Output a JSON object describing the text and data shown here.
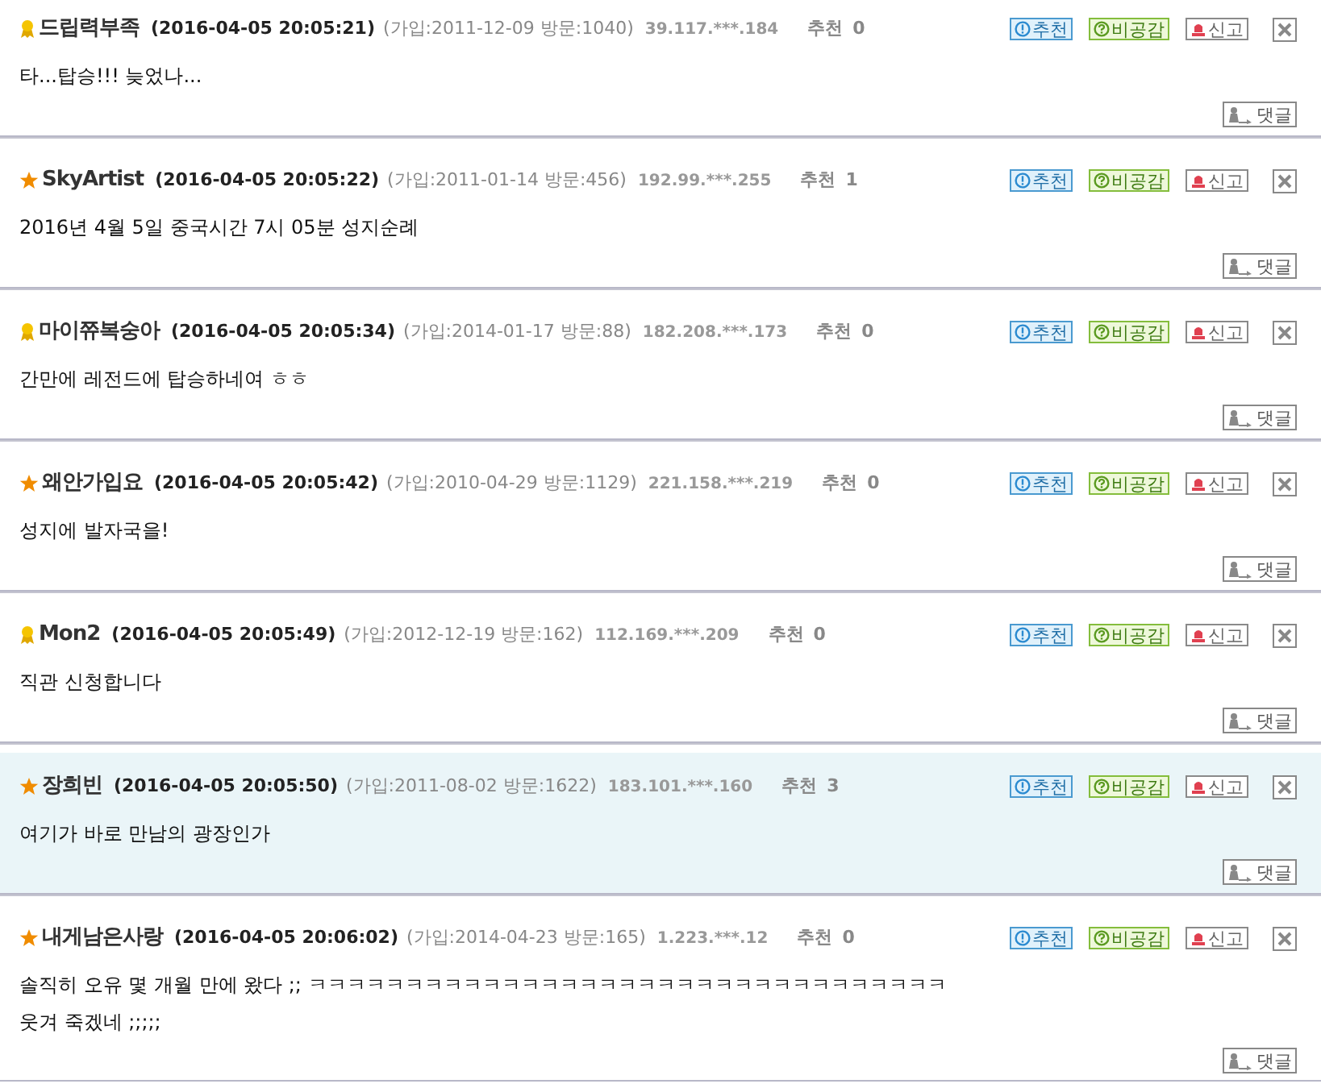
{
  "comments": [
    {
      "kind": "ribbon",
      "nickname": "드립력부족",
      "datetime": "(2016-04-05 20:05:21)",
      "member_info": "(가입:2011-12-09 방문:1040)",
      "ip": "39.117.***.184",
      "recommend_label": "추천",
      "recommend_count": "0",
      "highlighted": false,
      "lines": [
        "타...탑승!!! 늦었나..."
      ],
      "actions": [
        {
          "kind": "recommend",
          "label": "추천"
        },
        {
          "kind": "dislike",
          "label": "비공감"
        },
        {
          "kind": "report",
          "label": "신고"
        }
      ],
      "reply_label": "댓글"
    },
    {
      "kind": "star",
      "nickname": "SkyArtist",
      "datetime": "(2016-04-05 20:05:22)",
      "member_info": "(가입:2011-01-14 방문:456)",
      "ip": "192.99.***.255",
      "recommend_label": "추천",
      "recommend_count": "1",
      "highlighted": false,
      "lines": [
        "2016년 4월 5일 중국시간 7시 05분 성지순례"
      ],
      "actions": [
        {
          "kind": "recommend",
          "label": "추천"
        },
        {
          "kind": "dislike",
          "label": "비공감"
        },
        {
          "kind": "report",
          "label": "신고"
        }
      ],
      "reply_label": "댓글"
    },
    {
      "kind": "ribbon",
      "nickname": "마이쮸복숭아",
      "datetime": "(2016-04-05 20:05:34)",
      "member_info": "(가입:2014-01-17 방문:88)",
      "ip": "182.208.***.173",
      "recommend_label": "추천",
      "recommend_count": "0",
      "highlighted": false,
      "lines": [
        "간만에 레전드에 탑승하네여 ㅎㅎ"
      ],
      "actions": [
        {
          "kind": "recommend",
          "label": "추천"
        },
        {
          "kind": "dislike",
          "label": "비공감"
        },
        {
          "kind": "report",
          "label": "신고"
        }
      ],
      "reply_label": "댓글"
    },
    {
      "kind": "star",
      "nickname": "왜안가입요",
      "datetime": "(2016-04-05 20:05:42)",
      "member_info": "(가입:2010-04-29 방문:1129)",
      "ip": "221.158.***.219",
      "recommend_label": "추천",
      "recommend_count": "0",
      "highlighted": false,
      "lines": [
        "성지에 발자국을!"
      ],
      "actions": [
        {
          "kind": "recommend",
          "label": "추천"
        },
        {
          "kind": "dislike",
          "label": "비공감"
        },
        {
          "kind": "report",
          "label": "신고"
        }
      ],
      "reply_label": "댓글"
    },
    {
      "kind": "ribbon",
      "nickname": "Mon2",
      "datetime": "(2016-04-05 20:05:49)",
      "member_info": "(가입:2012-12-19 방문:162)",
      "ip": "112.169.***.209",
      "recommend_label": "추천",
      "recommend_count": "0",
      "highlighted": false,
      "lines": [
        "직관 신청합니다"
      ],
      "actions": [
        {
          "kind": "recommend",
          "label": "추천"
        },
        {
          "kind": "dislike",
          "label": "비공감"
        },
        {
          "kind": "report",
          "label": "신고"
        }
      ],
      "reply_label": "댓글"
    },
    {
      "kind": "star",
      "nickname": "장희빈",
      "datetime": "(2016-04-05 20:05:50)",
      "member_info": "(가입:2011-08-02 방문:1622)",
      "ip": "183.101.***.160",
      "recommend_label": "추천",
      "recommend_count": "3",
      "highlighted": true,
      "lines": [
        "여기가 바로 만남의 광장인가"
      ],
      "actions": [
        {
          "kind": "recommend",
          "label": "추천"
        },
        {
          "kind": "dislike",
          "label": "비공감"
        },
        {
          "kind": "report",
          "label": "신고"
        }
      ],
      "reply_label": "댓글"
    },
    {
      "kind": "star",
      "nickname": "내게남은사랑",
      "datetime": "(2016-04-05 20:06:02)",
      "member_info": "(가입:2014-04-23 방문:165)",
      "ip": "1.223.***.12",
      "recommend_label": "추천",
      "recommend_count": "0",
      "highlighted": false,
      "lines": [
        "솔직히 오유 몇 개월 만에 왔다 ;; ㅋㅋㅋㅋㅋㅋㅋㅋㅋㅋㅋㅋㅋㅋㅋㅋㅋㅋㅋㅋㅋㅋㅋㅋㅋㅋㅋㅋㅋㅋㅋㅋㅋ",
        "웃겨 죽겠네 ;;;;;"
      ],
      "actions": [
        {
          "kind": "recommend",
          "label": "추천"
        },
        {
          "kind": "dislike",
          "label": "비공감"
        },
        {
          "kind": "report",
          "label": "신고"
        }
      ],
      "reply_label": "댓글"
    }
  ]
}
